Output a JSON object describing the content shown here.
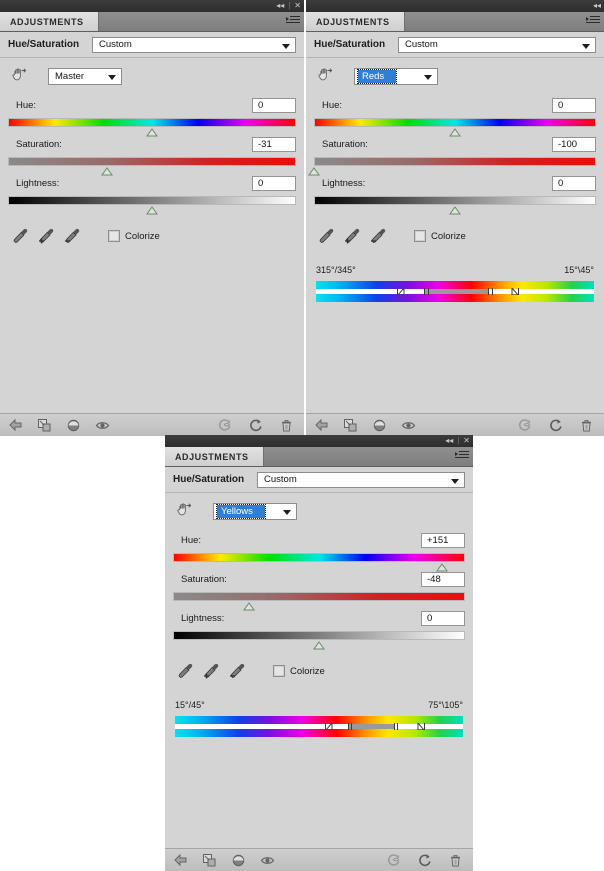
{
  "app": {
    "panel_tab_label": "ADJUSTMENTS",
    "adjustment_name": "Hue/Saturation",
    "preset_value": "Custom",
    "colorize_label": "Colorize",
    "window_collapse_icon": "collapse-icon",
    "window_close_icon": "close-icon",
    "panel_menu_icon": "panel-menu-icon",
    "target_adjust_icon": "on-image-adjustment-icon"
  },
  "slider_labels": {
    "hue": "Hue:",
    "saturation": "Saturation:",
    "lightness": "Lightness:"
  },
  "droppers": [
    {
      "name": "eyedropper-icon",
      "title": "eyedropper"
    },
    {
      "name": "eyedropper-add-icon",
      "title": "eyedropper-plus"
    },
    {
      "name": "eyedropper-subtract-icon",
      "title": "eyedropper-minus"
    }
  ],
  "toolbar": {
    "left": [
      {
        "name": "return-to-adjustment-list-icon"
      },
      {
        "name": "clip-to-layer-icon"
      },
      {
        "name": "toggle-layer-visibility-icon"
      },
      {
        "name": "preview-eye-icon"
      }
    ],
    "right": [
      {
        "name": "view-previous-state-icon"
      },
      {
        "name": "reset-adjustment-icon"
      },
      {
        "name": "delete-adjustment-layer-icon"
      }
    ]
  },
  "panels": [
    {
      "id": "panel-master",
      "channel": "Master",
      "channel_selected": false,
      "has_range": false,
      "has_close": true,
      "sliders": [
        {
          "key": "hue",
          "value": "0",
          "thumb_pct": 50.0
        },
        {
          "key": "saturation",
          "value": "-31",
          "thumb_pct": 34.5
        },
        {
          "key": "lightness",
          "value": "0",
          "thumb_pct": 50.0
        }
      ],
      "range": null
    },
    {
      "id": "panel-reds",
      "channel": "Reds",
      "channel_selected": true,
      "has_range": true,
      "has_close": false,
      "sliders": [
        {
          "key": "hue",
          "value": "0",
          "thumb_pct": 50.0
        },
        {
          "key": "saturation",
          "value": "-100",
          "thumb_pct": 0.0
        },
        {
          "key": "lightness",
          "value": "0",
          "thumb_pct": 50.0
        }
      ],
      "range": {
        "left_label": "315°/345°",
        "right_label": "15°\\45°",
        "fade_start_pct": 29.0,
        "core_start_pct": 39.0,
        "core_end_pct": 62.0,
        "fade_end_pct": 70.0
      }
    },
    {
      "id": "panel-yellows",
      "channel": "Yellows",
      "channel_selected": true,
      "has_range": true,
      "has_close": true,
      "sliders": [
        {
          "key": "hue",
          "value": "+151",
          "thumb_pct": 92.0
        },
        {
          "key": "saturation",
          "value": "-48",
          "thumb_pct": 26.0
        },
        {
          "key": "lightness",
          "value": "0",
          "thumb_pct": 50.0
        }
      ],
      "range": {
        "left_label": "15°/45°",
        "right_label": "75°\\105°",
        "fade_start_pct": 52.0,
        "core_start_pct": 60.0,
        "core_end_pct": 76.0,
        "fade_end_pct": 84.0
      }
    }
  ],
  "colors": {
    "panel_bg": "#d4d4d4",
    "tab_active": "#e2e2e2",
    "tabbar": "#8f8f8f",
    "selection_blue": "#2f7fd8",
    "titlebar": "#333333"
  }
}
